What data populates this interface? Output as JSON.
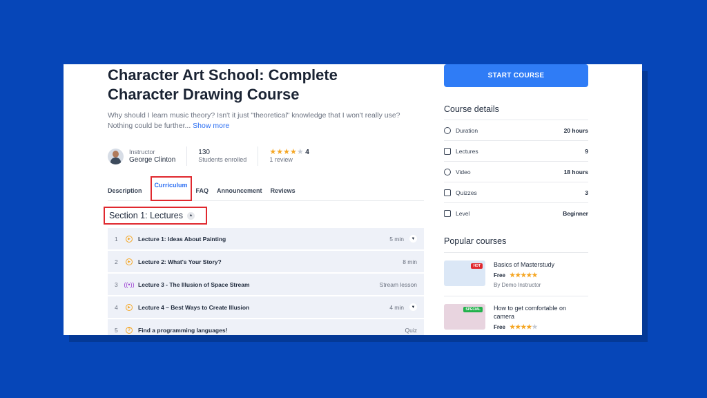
{
  "course": {
    "title": "Character Art School: Complete Character Drawing Course",
    "description": "Why should I learn music theory? Isn't it just \"theoretical\" knowledge that I won't really use? Nothing could be further...",
    "show_more": "Show more"
  },
  "instructor": {
    "label": "Instructor",
    "name": "George Clinton"
  },
  "enrolled": {
    "count": "130",
    "label": "Students enrolled"
  },
  "rating": {
    "value": "4",
    "reviews": "1 review",
    "stars": 4
  },
  "tabs": [
    "Description",
    "Curriculum",
    "FAQ",
    "Announcement",
    "Reviews"
  ],
  "active_tab": "Curriculum",
  "section": {
    "title": "Section 1: Lectures"
  },
  "lectures": [
    {
      "num": "1",
      "icon": "play-icon",
      "title": "Lecture 1: Ideas About Painting",
      "duration": "5 min",
      "expandable": true
    },
    {
      "num": "2",
      "icon": "play-icon",
      "title": "Lecture 2: What's Your Story?",
      "duration": "8 min",
      "expandable": false
    },
    {
      "num": "3",
      "icon": "stream-icon",
      "title": "Lecture 3 - The Illusion of Space Stream",
      "duration": "Stream lesson",
      "expandable": false
    },
    {
      "num": "4",
      "icon": "play-icon",
      "title": "Lecture 4 – Best Ways to Create Illusion",
      "duration": "4 min",
      "expandable": true
    },
    {
      "num": "5",
      "icon": "quiz-icon",
      "title": "Find a programming languages!",
      "duration": "Quiz",
      "expandable": false
    }
  ],
  "sidebar": {
    "start_button": "START COURSE",
    "details_title": "Course details",
    "details": [
      {
        "icon": "clock-icon",
        "label": "Duration",
        "value": "20 hours"
      },
      {
        "icon": "book-icon",
        "label": "Lectures",
        "value": "9"
      },
      {
        "icon": "video-icon",
        "label": "Video",
        "value": "18 hours"
      },
      {
        "icon": "quiz-icon",
        "label": "Quizzes",
        "value": "3"
      },
      {
        "icon": "level-icon",
        "label": "Level",
        "value": "Beginner"
      }
    ],
    "popular_title": "Popular courses",
    "popular": [
      {
        "title": "Basics of Masterstudy",
        "price": "Free",
        "stars": 5,
        "author": "By Demo Instructor",
        "badge": "HOT"
      },
      {
        "title": "How to get comfortable on camera",
        "price": "Free",
        "stars": 4,
        "author": "",
        "badge": "SPECIAL"
      }
    ]
  },
  "colors": {
    "background": "#0646b8",
    "accent": "#2f7cf6",
    "highlight": "#e0282e",
    "star": "#f5a623"
  }
}
